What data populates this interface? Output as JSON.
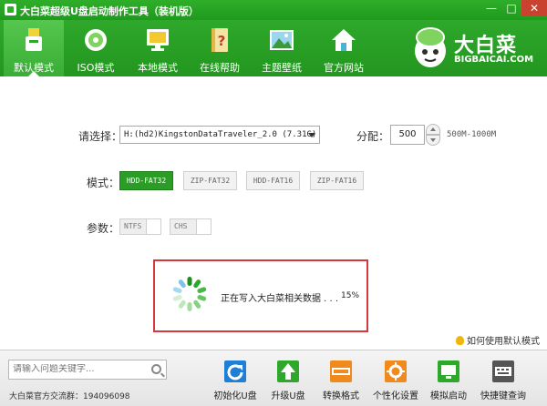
{
  "window": {
    "title": "大白菜超级U盘启动制作工具（装机版）",
    "min_label": "—",
    "max_label": "□",
    "close_label": "✕"
  },
  "toolbar": {
    "items": [
      {
        "label": "默认模式",
        "icon": "usb-drive-icon",
        "active": true
      },
      {
        "label": "ISO模式",
        "icon": "disc-icon",
        "active": false
      },
      {
        "label": "本地模式",
        "icon": "monitor-icon",
        "active": false
      },
      {
        "label": "在线帮助",
        "icon": "help-book-icon",
        "active": false
      },
      {
        "label": "主题壁纸",
        "icon": "wallpaper-icon",
        "active": false
      },
      {
        "label": "官方网站",
        "icon": "home-icon",
        "active": false
      }
    ]
  },
  "brand": {
    "name": "大白菜",
    "url": "BIGBAICAI.COM"
  },
  "form": {
    "select_label": "请选择：",
    "device_value": "H:(hd2)KingstonDataTraveler_2.0 (7.31G)",
    "partition_label": "分配：",
    "partition_value": "500",
    "partition_range": "500M-1000M",
    "mode_label": "模式：",
    "modes": [
      {
        "label": "HDD-FAT32",
        "selected": true
      },
      {
        "label": "ZIP-FAT32",
        "selected": false
      },
      {
        "label": "HDD-FAT16",
        "selected": false
      },
      {
        "label": "ZIP-FAT16",
        "selected": false
      }
    ],
    "params_label": "参数：",
    "params": [
      {
        "label": "NTFS"
      },
      {
        "label": "CHS"
      }
    ]
  },
  "progress": {
    "text": "正在写入大白菜相关数据 . . .",
    "percent_label": "15%",
    "percent": 15
  },
  "help_link": "如何使用默认模式",
  "bottom": {
    "search_placeholder": "请输入问题关键字...",
    "qq_group": "大白菜官方交流群：194096098",
    "buttons": [
      {
        "label": "初始化U盘",
        "icon": "refresh-icon",
        "color": "#1e7fd6"
      },
      {
        "label": "升级U盘",
        "icon": "upgrade-arrow-icon",
        "color": "#2ea82b"
      },
      {
        "label": "转换格式",
        "icon": "ntfs-icon",
        "color": "#f08a1c"
      },
      {
        "label": "个性化设置",
        "icon": "gear-icon",
        "color": "#f08a1c"
      },
      {
        "label": "模拟启动",
        "icon": "simulate-icon",
        "color": "#2ea82b"
      },
      {
        "label": "快捷键查询",
        "icon": "keyboard-icon",
        "color": "#555555"
      }
    ]
  },
  "colors": {
    "brand_green": "#2ea82b",
    "highlight_red": "#d7373a"
  }
}
